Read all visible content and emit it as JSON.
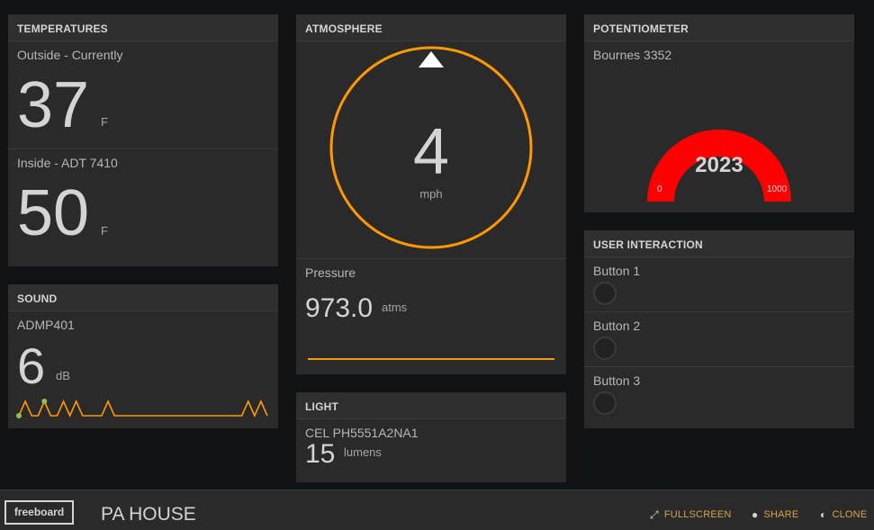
{
  "temperatures": {
    "header": "TEMPERATURES",
    "outside": {
      "title": "Outside - Currently",
      "value": "37",
      "units": "F"
    },
    "inside": {
      "title": "Inside - ADT 7410",
      "value": "50",
      "units": "F"
    }
  },
  "sound": {
    "header": "SOUND",
    "title": "ADMP401",
    "value": "6",
    "units": "dB",
    "sparkline": [
      1,
      3,
      1,
      1,
      3,
      1,
      1,
      3,
      1,
      3,
      1,
      1,
      1,
      1,
      3,
      1,
      1,
      1,
      1,
      1,
      1,
      1,
      1,
      1,
      1,
      1,
      1,
      1,
      1,
      1,
      1,
      1,
      1,
      1,
      1,
      1,
      3,
      1,
      3,
      1
    ]
  },
  "atmosphere": {
    "header": "ATMOSPHERE",
    "wind": {
      "value": "4",
      "units": "mph",
      "direction_deg": 0
    },
    "pressure": {
      "title": "Pressure",
      "value": "973.0",
      "units": "atms"
    }
  },
  "light": {
    "header": "LIGHT",
    "title": "CEL PH5551A2NA1",
    "value": "15",
    "units": "lumens"
  },
  "potentiometer": {
    "header": "POTENTIOMETER",
    "title": "Bournes 3352",
    "gauge": {
      "value": "2023",
      "min": "0",
      "max": "1000",
      "fill_fraction": 1.0
    }
  },
  "user_interaction": {
    "header": "USER INTERACTION",
    "buttons": [
      {
        "label": "Button 1"
      },
      {
        "label": "Button 2"
      },
      {
        "label": "Button 3"
      }
    ]
  },
  "footer": {
    "logo": "freeboard",
    "board_title": "PA HOUSE",
    "fullscreen": "FULLSCREEN",
    "share": "SHARE",
    "clone": "CLONE"
  },
  "colors": {
    "accent": "#ff9900",
    "gauge_fill": "#ff0000",
    "sparkline_dot": "#8cc152"
  }
}
